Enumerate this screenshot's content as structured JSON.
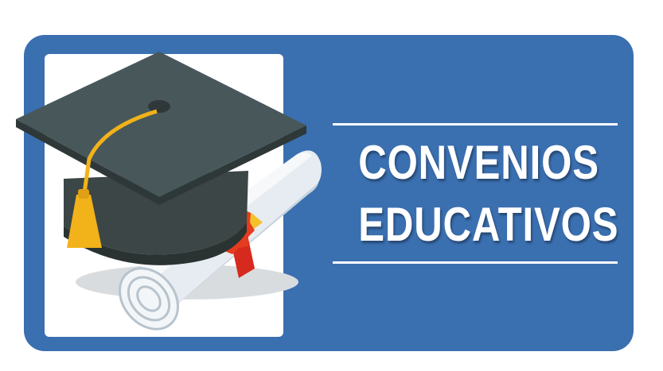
{
  "title": {
    "line1": "CONVENIOS",
    "line2": "EDUCATIVOS"
  },
  "icons": [
    "graduation-cap-icon",
    "diploma-scroll-icon",
    "wax-seal-icon"
  ],
  "colors": {
    "banner": "#3a6fb0",
    "panel": "#ffffff",
    "text": "#ffffff",
    "cap": "#3f4a4a",
    "tassel": "#f2b21a",
    "scroll": "#e3e9ee",
    "seal": "#e53b1e",
    "ribbon": "#d62a1e"
  }
}
